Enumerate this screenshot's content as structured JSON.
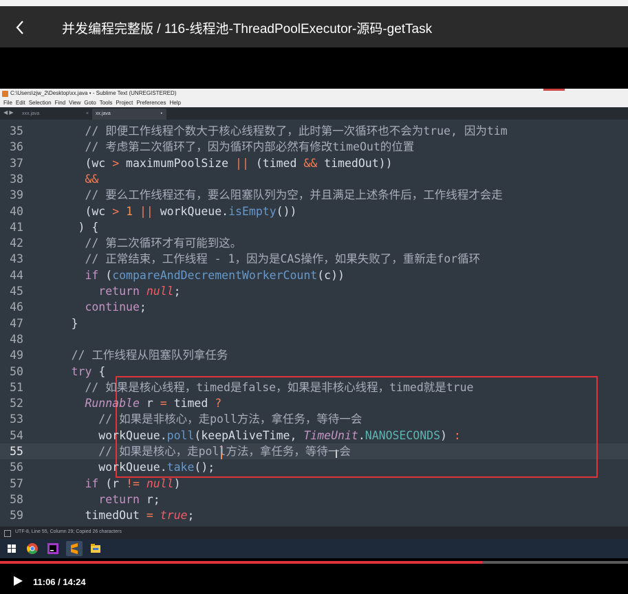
{
  "player": {
    "title": "并发编程完整版 / 116-线程池-ThreadPoolExecutor-源码-getTask",
    "time_display": "11:06 / 14:24",
    "progress": 0.768
  },
  "sublime": {
    "window_title": "C:\\Users\\zjw_2\\Desktop\\xx.java • - Sublime Text (UNREGISTERED)",
    "menu": [
      "File",
      "Edit",
      "Selection",
      "Find",
      "View",
      "Goto",
      "Tools",
      "Project",
      "Preferences",
      "Help"
    ],
    "tabs": [
      {
        "name": "xxx.java",
        "close": "×",
        "active": false
      },
      {
        "name": "xx.java",
        "close": "•",
        "active": true
      }
    ],
    "status_text": "UTF-8, Line 55, Column 29; Copied 26 characters",
    "current_line": "55"
  },
  "code_lines": [
    {
      "n": "35",
      "indent": 8,
      "parts": [
        [
          "c-cm",
          "// 即便工作线程个数大于核心线程数了，此时第一次循环也不会为true, 因为tim"
        ]
      ]
    },
    {
      "n": "36",
      "indent": 8,
      "parts": [
        [
          "c-cm",
          "// 考虑第二次循环了，因为循环内部必然有修改timeOut的位置"
        ]
      ]
    },
    {
      "n": "37",
      "indent": 8,
      "parts": [
        [
          "c-pl",
          "(wc "
        ],
        [
          "c-op",
          ">"
        ],
        [
          "c-pl",
          " maximumPoolSize "
        ],
        [
          "c-op",
          "||"
        ],
        [
          "c-pl",
          " (timed "
        ],
        [
          "c-op",
          "&&"
        ],
        [
          "c-pl",
          " timedOut))"
        ]
      ]
    },
    {
      "n": "38",
      "indent": 8,
      "parts": [
        [
          "c-op",
          "&&"
        ]
      ]
    },
    {
      "n": "39",
      "indent": 8,
      "parts": [
        [
          "c-cm",
          "// 要么工作线程还有，要么阻塞队列为空，并且满足上述条件后，工作线程才会走"
        ]
      ]
    },
    {
      "n": "40",
      "indent": 8,
      "parts": [
        [
          "c-pl",
          "(wc "
        ],
        [
          "c-op",
          ">"
        ],
        [
          "c-pl",
          " "
        ],
        [
          "c-nm",
          "1"
        ],
        [
          "c-pl",
          " "
        ],
        [
          "c-op",
          "||"
        ],
        [
          "c-pl",
          " workQueue."
        ],
        [
          "c-fn",
          "isEmpty"
        ],
        [
          "c-pl",
          "())"
        ]
      ]
    },
    {
      "n": "41",
      "indent": 7,
      "parts": [
        [
          "c-pl",
          ") {"
        ]
      ]
    },
    {
      "n": "42",
      "indent": 8,
      "parts": [
        [
          "c-cm",
          "// 第二次循环才有可能到这。"
        ]
      ]
    },
    {
      "n": "43",
      "indent": 8,
      "parts": [
        [
          "c-cm",
          "// 正常结束，工作线程 - 1，因为是CAS操作，如果失败了，重新走for循环"
        ]
      ]
    },
    {
      "n": "44",
      "indent": 8,
      "parts": [
        [
          "c-kw",
          "if"
        ],
        [
          "c-pl",
          " ("
        ],
        [
          "c-fn",
          "compareAndDecrementWorkerCount"
        ],
        [
          "c-pl",
          "(c))"
        ]
      ]
    },
    {
      "n": "45",
      "indent": 10,
      "parts": [
        [
          "c-kw",
          "return"
        ],
        [
          "c-pl",
          " "
        ],
        [
          "c-it",
          "null"
        ],
        [
          "c-pl",
          ";"
        ]
      ]
    },
    {
      "n": "46",
      "indent": 8,
      "parts": [
        [
          "c-kw",
          "continue"
        ],
        [
          "c-pl",
          ";"
        ]
      ]
    },
    {
      "n": "47",
      "indent": 6,
      "parts": [
        [
          "c-pl",
          "}"
        ]
      ]
    },
    {
      "n": "48",
      "indent": 0,
      "parts": []
    },
    {
      "n": "49",
      "indent": 6,
      "parts": [
        [
          "c-cm",
          "// 工作线程从阻塞队列拿任务"
        ]
      ]
    },
    {
      "n": "50",
      "indent": 6,
      "parts": [
        [
          "c-kw",
          "try"
        ],
        [
          "c-pl",
          " {"
        ]
      ]
    },
    {
      "n": "51",
      "indent": 8,
      "parts": [
        [
          "c-cm",
          "// 如果是核心线程，timed是false，如果是非核心线程，timed就是true"
        ]
      ]
    },
    {
      "n": "52",
      "indent": 8,
      "parts": [
        [
          "c-ty",
          "Runnable"
        ],
        [
          "c-pl",
          " r "
        ],
        [
          "c-op",
          "="
        ],
        [
          "c-pl",
          " timed "
        ],
        [
          "c-op",
          "?"
        ]
      ]
    },
    {
      "n": "53",
      "indent": 10,
      "parts": [
        [
          "c-cm",
          "// 如果是非核心，走poll方法，拿任务，等待一会"
        ]
      ]
    },
    {
      "n": "54",
      "indent": 10,
      "parts": [
        [
          "c-pl",
          "workQueue."
        ],
        [
          "c-fn",
          "poll"
        ],
        [
          "c-pl",
          "(keepAliveTime, "
        ],
        [
          "c-ty",
          "TimeUnit"
        ],
        [
          "c-pl",
          "."
        ],
        [
          "c-cs",
          "NANOSECONDS"
        ],
        [
          "c-pl",
          ") "
        ],
        [
          "c-op",
          ":"
        ]
      ]
    },
    {
      "n": "55",
      "indent": 10,
      "parts": [
        [
          "c-cm",
          "// 如果是核心，走poll方法，拿任务，等待一会"
        ]
      ]
    },
    {
      "n": "56",
      "indent": 10,
      "parts": [
        [
          "c-pl",
          "workQueue."
        ],
        [
          "c-fn",
          "take"
        ],
        [
          "c-pl",
          "();"
        ]
      ]
    },
    {
      "n": "57",
      "indent": 8,
      "parts": [
        [
          "c-kw",
          "if"
        ],
        [
          "c-pl",
          " (r "
        ],
        [
          "c-op",
          "!="
        ],
        [
          "c-pl",
          " "
        ],
        [
          "c-it",
          "null"
        ],
        [
          "c-pl",
          ")"
        ]
      ]
    },
    {
      "n": "58",
      "indent": 10,
      "parts": [
        [
          "c-kw",
          "return"
        ],
        [
          "c-pl",
          " r;"
        ]
      ]
    },
    {
      "n": "59",
      "indent": 8,
      "parts": [
        [
          "c-pl",
          "timedOut "
        ],
        [
          "c-op",
          "="
        ],
        [
          "c-pl",
          " "
        ],
        [
          "c-it",
          "true"
        ],
        [
          "c-pl",
          ";"
        ]
      ]
    }
  ],
  "icons": {
    "back": "chevron-left-icon",
    "play": "play-icon",
    "taskbar": [
      "windows-start-icon",
      "chrome-icon",
      "intellij-icon",
      "sublime-icon",
      "file-explorer-icon"
    ]
  },
  "colors": {
    "editor_bg": "#303841",
    "highlight_box": "#e0343a",
    "progress": "#e0343a"
  }
}
